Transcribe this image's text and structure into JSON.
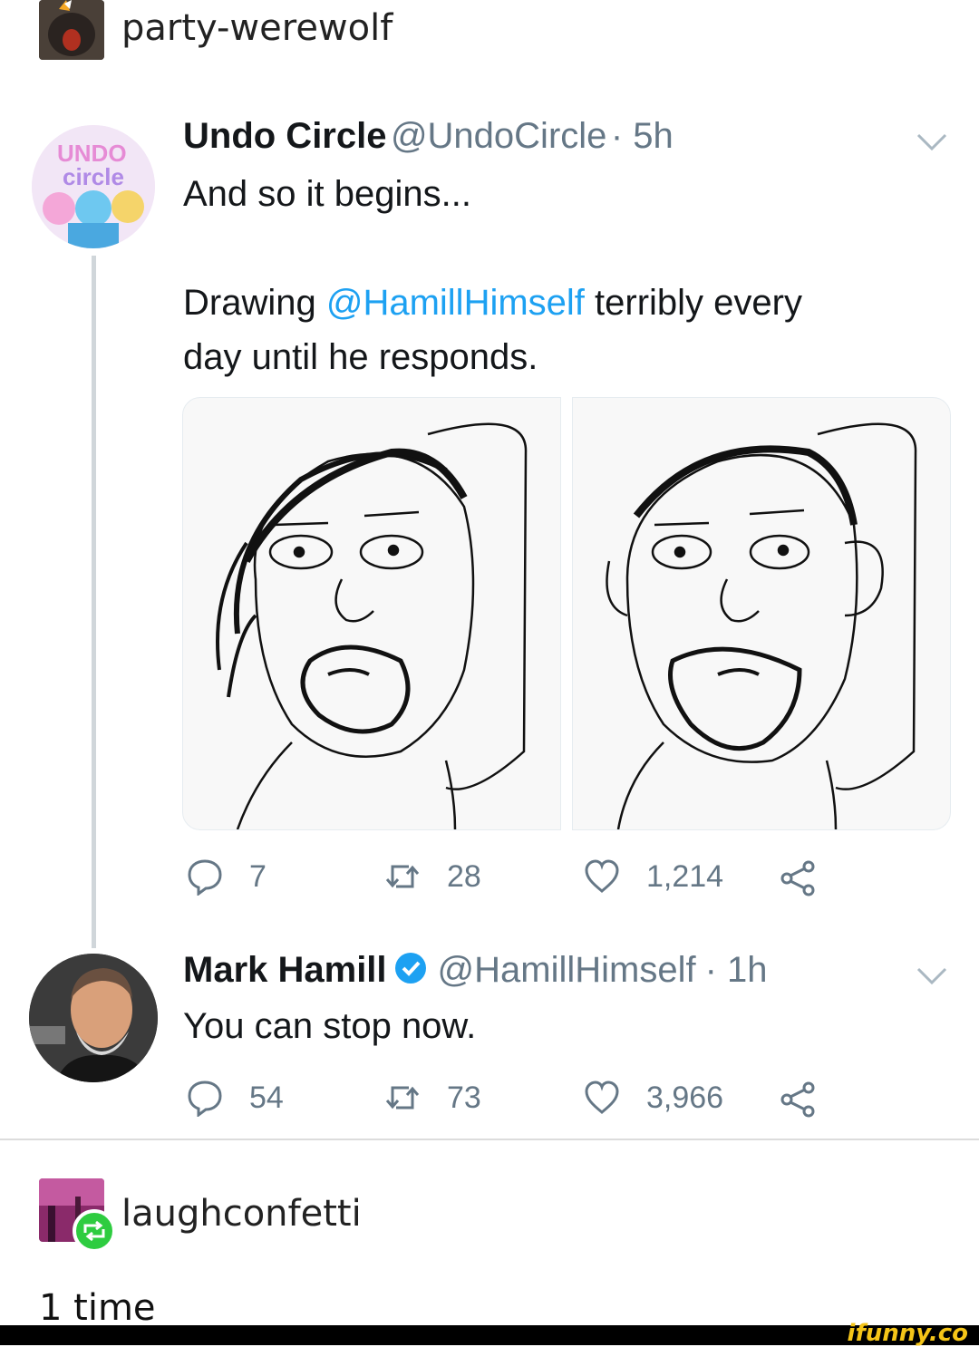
{
  "post": {
    "blog": "party-werewolf",
    "tweets": [
      {
        "name": "Undo Circle",
        "handle": "@UndoCircle",
        "time": "· 5h",
        "text_line1": "And so it begins...",
        "text_line2_pre": "Drawing ",
        "mention": "@HamillHimself",
        "text_line2_post": " terribly every",
        "text_line3": "day until he responds.",
        "actions": {
          "replies": "7",
          "retweets": "28",
          "likes": "1,214"
        }
      },
      {
        "name": "Mark Hamill",
        "verified": true,
        "handle": "@HamillHimself",
        "time": "· 1h",
        "text": "You can stop now.",
        "actions": {
          "replies": "54",
          "retweets": "73",
          "likes": "3,966"
        }
      }
    ]
  },
  "reblog": {
    "blog": "laughconfetti",
    "count": "1 time"
  },
  "watermark": "ifunny.co",
  "colors": {
    "accent": "#1da1f2",
    "muted": "#657786",
    "reblog_green": "#2ecc40"
  }
}
